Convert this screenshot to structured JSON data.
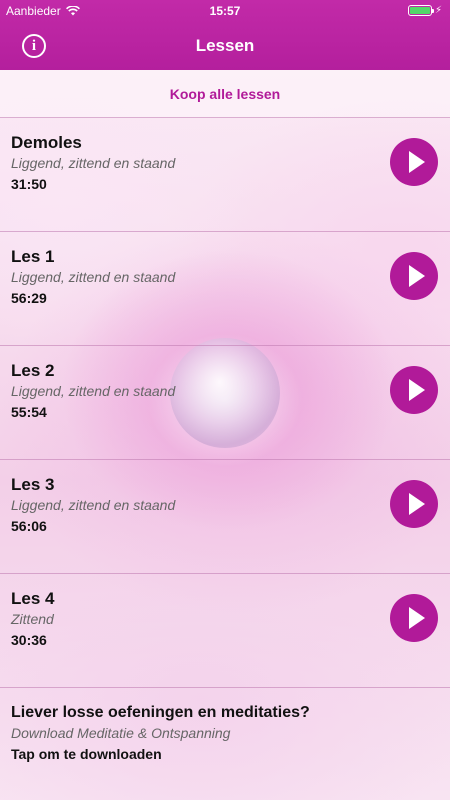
{
  "status_bar": {
    "carrier": "Aanbieder",
    "time": "15:57",
    "battery_level": 1.0
  },
  "header": {
    "title": "Lessen",
    "info_icon": "info-icon",
    "info_glyph": "i",
    "color": "#b41f9d"
  },
  "buy_all": {
    "label": "Koop alle lessen",
    "color": "#b11a99"
  },
  "lessons": [
    {
      "title": "Demoles",
      "subtitle": "Liggend, zittend en staand",
      "duration": "31:50"
    },
    {
      "title": "Les 1",
      "subtitle": "Liggend, zittend en staand",
      "duration": "56:29"
    },
    {
      "title": "Les 2",
      "subtitle": "Liggend, zittend en staand",
      "duration": "55:54"
    },
    {
      "title": "Les 3",
      "subtitle": "Liggend, zittend en staand",
      "duration": "56:06"
    },
    {
      "title": "Les 4",
      "subtitle": "Zittend",
      "duration": "30:36"
    }
  ],
  "promo": {
    "title": "Liever losse oefeningen en meditaties?",
    "subtitle": "Download Meditatie & Ontspanning",
    "action": "Tap om te downloaden"
  },
  "icons": {
    "play": "play-icon",
    "wifi": "wifi-icon",
    "battery": "battery-icon",
    "charging": "bolt-icon"
  }
}
